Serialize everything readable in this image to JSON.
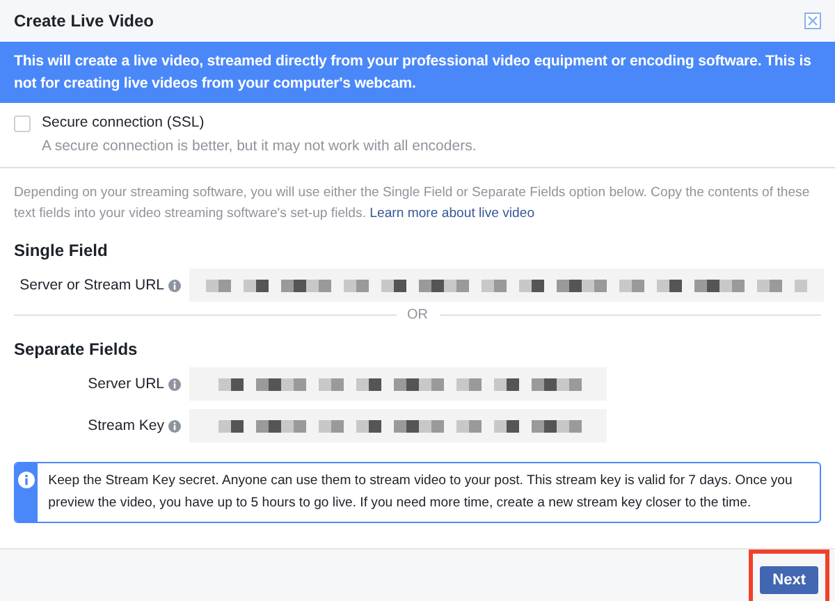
{
  "window": {
    "title": "Create Live Video"
  },
  "banner": "This will create a live video, streamed directly from your professional video equipment or encoding software. This is not for creating live videos from your computer's webcam.",
  "secure": {
    "label": "Secure connection (SSL)",
    "hint": "A secure connection is better, but it may not work with all encoders.",
    "checked": false
  },
  "intro": {
    "text": "Depending on your streaming software, you will use either the Single Field or Separate Fields option below. Copy the contents of these text fields into your video streaming software's set-up fields.",
    "link": "Learn more about live video"
  },
  "single": {
    "heading": "Single Field",
    "fields": [
      {
        "label": "Server or Stream URL"
      }
    ]
  },
  "divider": "OR",
  "separate": {
    "heading": "Separate Fields",
    "fields": [
      {
        "label": "Server URL"
      },
      {
        "label": "Stream Key"
      }
    ]
  },
  "notice": "Keep the Stream Key secret. Anyone can use them to stream video to your post. This stream key is valid for 7 days. Once you preview the video, you have up to 5 hours to go live. If you need more time, create a new stream key closer to the time.",
  "buttons": [
    {
      "label": "Next",
      "highlighted": true
    }
  ]
}
